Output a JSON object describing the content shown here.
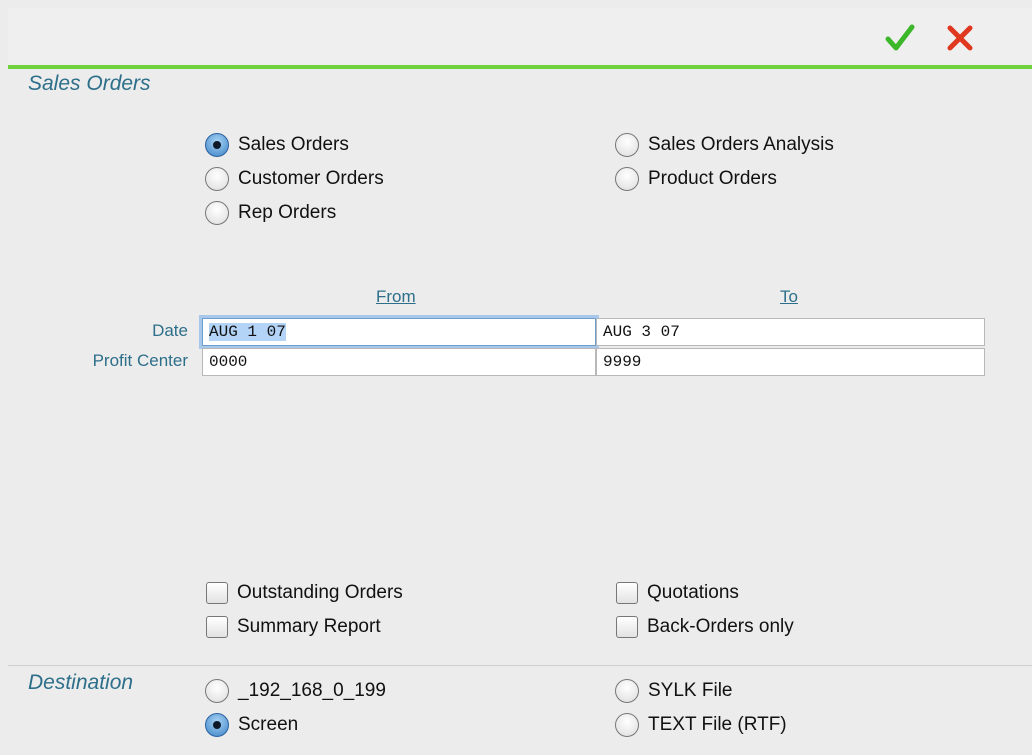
{
  "toolbar": {
    "ok_icon": "checkmark-icon",
    "cancel_icon": "close-icon",
    "ok_color": "#3cb72a",
    "cancel_color": "#e0371f"
  },
  "report_type": {
    "title": "Sales Orders",
    "options": [
      {
        "label": "Sales Orders",
        "selected": true
      },
      {
        "label": "Customer Orders",
        "selected": false
      },
      {
        "label": "Rep Orders",
        "selected": false
      },
      {
        "label": "Sales Orders Analysis",
        "selected": false
      },
      {
        "label": "Product Orders",
        "selected": false
      }
    ]
  },
  "range": {
    "from_label": "From",
    "to_label": "To",
    "rows": [
      {
        "label": "Date",
        "from": "AUG 1 07",
        "to": "AUG 3 07"
      },
      {
        "label": "Profit Center",
        "from": "0000",
        "to": "9999"
      }
    ]
  },
  "filters": {
    "options": [
      {
        "label": "Outstanding Orders",
        "checked": false
      },
      {
        "label": "Summary Report",
        "checked": false
      },
      {
        "label": "Quotations",
        "checked": false
      },
      {
        "label": "Back-Orders only",
        "checked": false
      }
    ]
  },
  "destination": {
    "title": "Destination",
    "options": [
      {
        "label": "_192_168_0_199",
        "selected": false
      },
      {
        "label": "Screen",
        "selected": true
      },
      {
        "label": "SYLK File",
        "selected": false
      },
      {
        "label": "TEXT File (RTF)",
        "selected": false
      }
    ]
  }
}
